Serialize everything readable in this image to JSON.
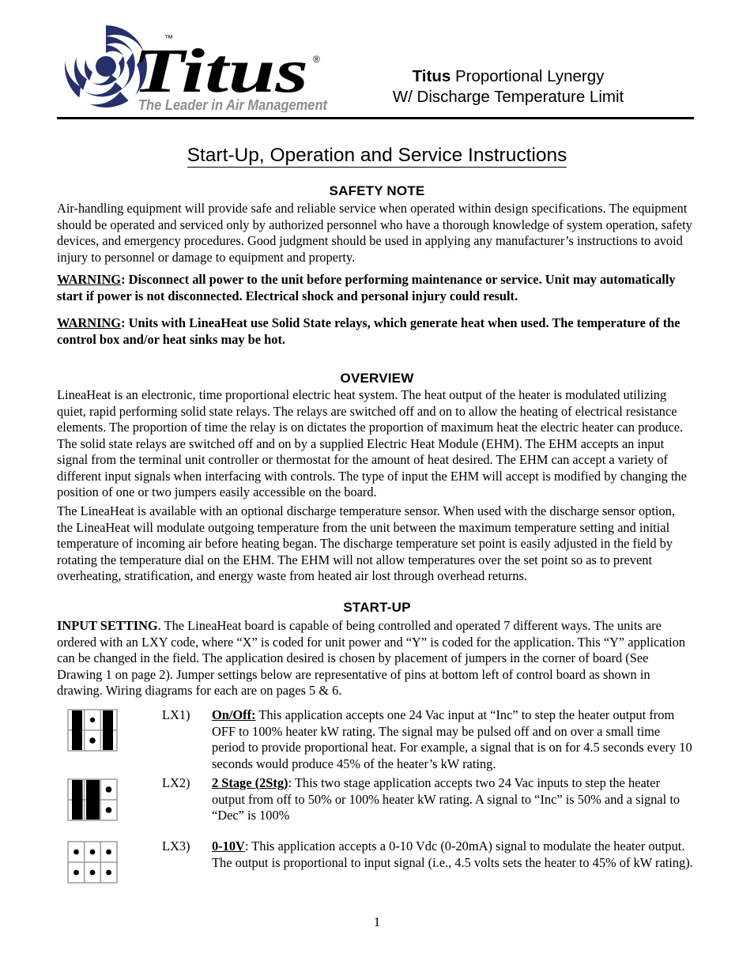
{
  "header": {
    "logo": {
      "brand": "Titus",
      "trademark": "™",
      "registered": "®",
      "tagline": "The Leader in Air Management",
      "swirl_color": "#26316b",
      "brand_color": "#000000",
      "tagline_color": "#8c8c8c"
    },
    "title_line1_bold": "Titus",
    "title_line1_rest": " Proportional Lynergy",
    "title_line2": "W/ Discharge Temperature Limit"
  },
  "document": {
    "title": "Start-Up, Operation and Service Instructions",
    "page_number": "1"
  },
  "sections": {
    "safety": {
      "heading": "SAFETY NOTE",
      "body": "Air-handling equipment will provide safe and reliable service when operated within design specifications.  The equipment should be operated and serviced only by authorized personnel who have a thorough knowledge of system operation, safety devices, and emergency procedures. Good judgment should be used in applying any manufacturer’s instructions to avoid injury to personnel or damage to equipment and property.",
      "warning_label": "WARNING",
      "warning1": ": Disconnect all power to the unit before performing maintenance or service. Unit may automatically start if power is not disconnected. Electrical shock and personal injury could result.",
      "warning2": ":  Units with LineaHeat use Solid State relays, which generate heat when used.  The temperature of the control box and/or heat sinks may be hot."
    },
    "overview": {
      "heading": "OVERVIEW",
      "para1": "LineaHeat is an electronic, time proportional electric heat system.  The heat output of the heater is modulated utilizing quiet, rapid performing solid state relays.  The relays are switched off and on to allow the heating of electrical resistance elements.  The proportion of time the relay is on dictates the proportion of maximum heat the electric heater can produce.  The solid state relays are switched off and on by a supplied Electric Heat Module (EHM).  The EHM accepts an input signal from the terminal unit controller or thermostat for the amount of heat desired.   The EHM can accept a variety of different input signals when interfacing with controls.  The type of input the EHM will accept is modified by changing the position of one or two jumpers easily accessible on the board.",
      "para2": "The LineaHeat is available with an optional discharge temperature sensor.  When used with the discharge sensor option, the LineaHeat will modulate outgoing temperature from the unit between the maximum temperature setting and initial temperature of incoming air before heating began.  The discharge temperature set point is easily adjusted in the field by rotating the temperature dial on the EHM.  The EHM will not allow temperatures over the set point so as to prevent overheating, stratification, and energy waste from heated air lost through overhead returns."
    },
    "startup": {
      "heading": "START-UP",
      "input_setting_label": "INPUT SETTING",
      "input_setting_body": ".  The LineaHeat board is capable of being controlled and operated 7 different ways.  The units are ordered with an LXY code, where “X” is coded for unit power and “Y” is coded for the application.  This “Y” application can be changed in the field.  The application desired is chosen by placement of jumpers in the corner of board (See Drawing 1 on page 2).  Jumper settings below are representative of pins at bottom left of control board as shown in drawing.  Wiring diagrams for each are on pages 5 & 6."
    }
  },
  "lx_items": [
    {
      "code": "LX1)",
      "name": "On/Off:",
      "description": " This application accepts one 24 Vac input at “Inc” to step the heater output from OFF to 100% heater kW rating.  The signal may be pulsed off and on over a small time period to provide proportional heat.  For example, a signal that is on for 4.5 seconds every 10 seconds would produce 45% of the heater’s kW rating.",
      "diagram_name": "jumper-diagram-on-off",
      "jumper_columns": [
        "filled",
        "open",
        "filled"
      ]
    },
    {
      "code": "LX2)",
      "name": "2 Stage (2Stg)",
      "description": ":  This two stage application accepts two 24 Vac inputs to step the heater output from off to 50% or 100% heater kW rating.  A signal to “Inc” is 50% and a signal to “Dec” is 100%",
      "diagram_name": "jumper-diagram-2-stage",
      "jumper_columns": [
        "filled",
        "filled",
        "open"
      ]
    },
    {
      "code": "LX3)",
      "name": "0-10V",
      "description": ":  This application accepts a 0-10 Vdc (0-20mA) signal to modulate the heater output.  The output is proportional to input signal (i.e., 4.5 volts sets the heater to 45% of kW rating).",
      "diagram_name": "jumper-diagram-0-10v",
      "jumper_columns": [
        "open",
        "open",
        "open"
      ]
    }
  ]
}
